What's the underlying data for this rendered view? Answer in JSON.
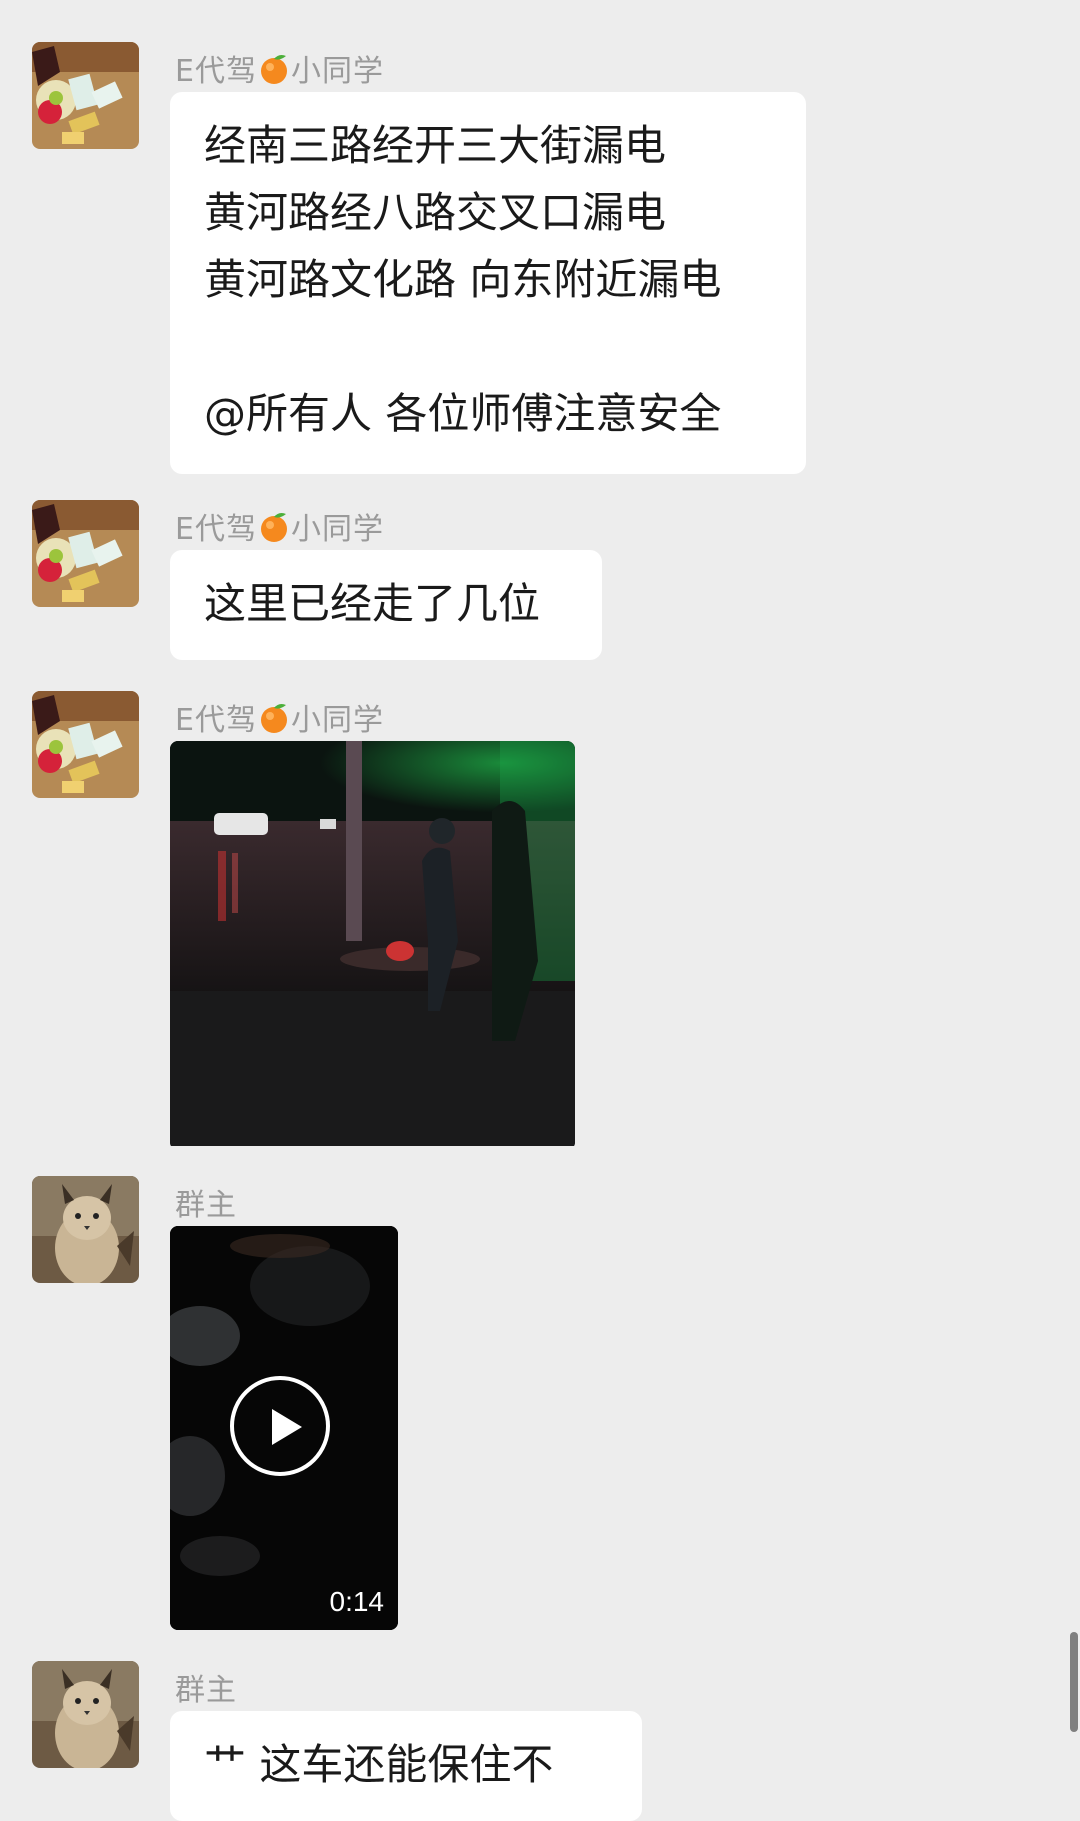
{
  "messages": [
    {
      "sender": "E代驾🍊小同学",
      "type": "text",
      "lines": [
        "经南三路经开三大街漏电",
        "黄河路经八路交叉口漏电",
        "黄河路文化路 向东附近漏电",
        "",
        "@所有人  各位师傅注意安全"
      ]
    },
    {
      "sender": "E代驾🍊小同学",
      "type": "text",
      "lines": [
        "这里已经走了几位"
      ]
    },
    {
      "sender": "E代驾🍊小同学",
      "type": "image",
      "image_icon": "photo-flooded-street-night"
    },
    {
      "sender": "群主",
      "type": "video",
      "duration": "0:14"
    },
    {
      "sender": "群主",
      "type": "text",
      "lines": [
        "艹  这车还能保住不"
      ]
    }
  ],
  "colors": {
    "background": "#ededed",
    "bubble": "#ffffff",
    "sender_text": "#9a9a9a",
    "message_text": "#1a1a1a"
  },
  "icons": {
    "sender_emoji": "orange-emoji",
    "video_play": "play-icon",
    "avatar_1": "snacks-photo-avatar",
    "avatar_2": "lynx-photo-avatar"
  }
}
